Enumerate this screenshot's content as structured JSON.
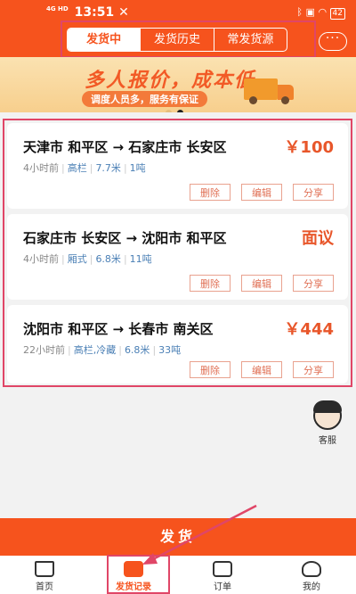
{
  "status_bar": {
    "time": "13:51",
    "network_label": "4G HD",
    "battery": "42"
  },
  "header": {
    "tabs": [
      "发货中",
      "发货历史",
      "常发货源"
    ],
    "active_tab": 0,
    "more_icon": "ellipsis-icon",
    "more_text": "···"
  },
  "banner": {
    "title": "多人报价，成本低",
    "subtitle": "调度人员多，服务有保证"
  },
  "orders": [
    {
      "route": "天津市 和平区 → 石家庄市 长安区",
      "price": "￥100",
      "time": "4小时前",
      "tags": [
        "高栏",
        "7.7米",
        "1吨"
      ],
      "actions": [
        "删除",
        "编辑",
        "分享"
      ]
    },
    {
      "route": "石家庄市 长安区 → 沈阳市 和平区",
      "price": "面议",
      "time": "4小时前",
      "tags": [
        "厢式",
        "6.8米",
        "11吨"
      ],
      "actions": [
        "删除",
        "编辑",
        "分享"
      ]
    },
    {
      "route": "沈阳市 和平区 → 长春市 南关区",
      "price": "￥444",
      "time": "22小时前",
      "tags": [
        "高栏,冷藏",
        "6.8米",
        "33吨"
      ],
      "actions": [
        "删除",
        "编辑",
        "分享"
      ]
    }
  ],
  "customer_service": {
    "label": "客服"
  },
  "ship_button": {
    "label": "发货"
  },
  "bottom_nav": [
    {
      "label": "首页",
      "icon": "home-icon"
    },
    {
      "label": "发货记录",
      "icon": "document-icon"
    },
    {
      "label": "订单",
      "icon": "list-icon"
    },
    {
      "label": "我的",
      "icon": "user-icon"
    }
  ],
  "bottom_nav_active": 1,
  "colors": {
    "brand": "#f6531d",
    "annotation": "#e04667",
    "price": "#e8562a"
  }
}
